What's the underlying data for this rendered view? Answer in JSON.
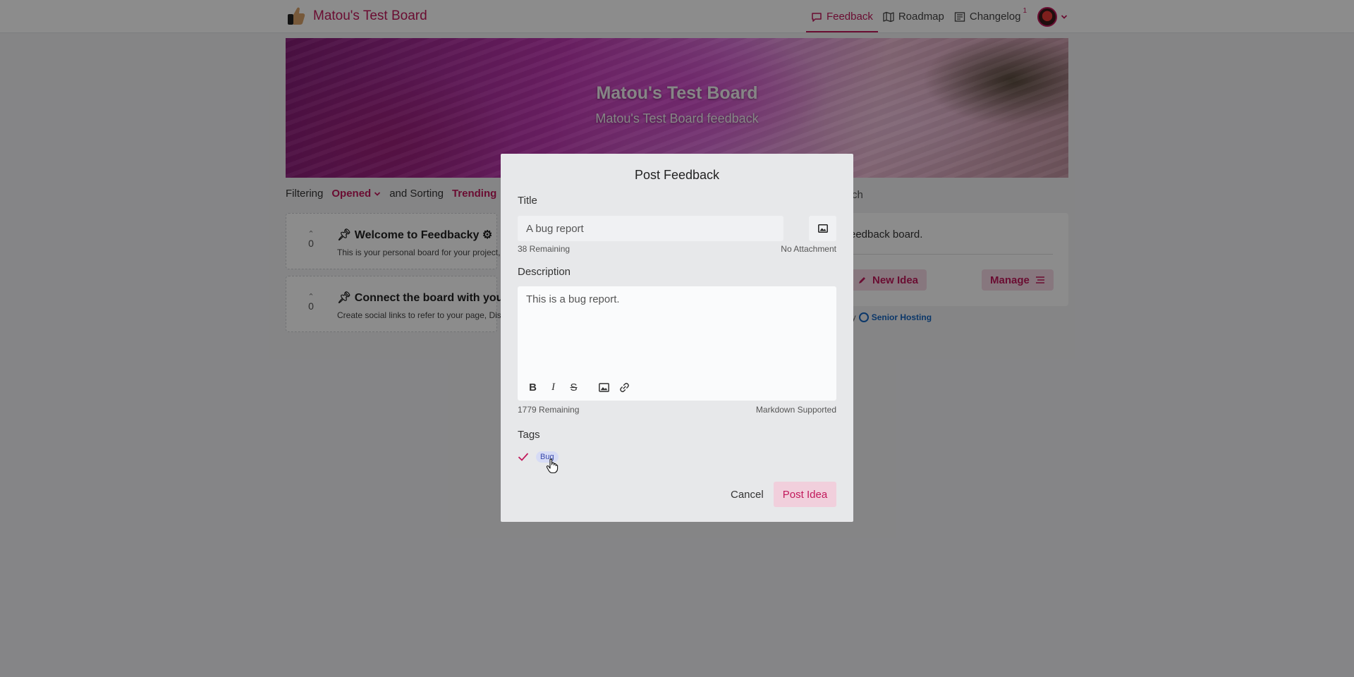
{
  "navbar": {
    "brand_title": "Matou's Test Board",
    "links": [
      {
        "label": "Feedback",
        "icon": "chat-bubble-icon",
        "active": true
      },
      {
        "label": "Roadmap",
        "icon": "map-icon",
        "active": false
      },
      {
        "label": "Changelog",
        "icon": "newspaper-icon",
        "active": false,
        "badge": "1"
      }
    ]
  },
  "banner": {
    "title": "Matou's Test Board",
    "subtitle": "Matou's Test Board feedback"
  },
  "filters": {
    "filtering_label": "Filtering",
    "filtering_value": "Opened",
    "sorting_label": "and Sorting",
    "sorting_value": "Trending",
    "search_fragment": "ch"
  },
  "posts": [
    {
      "title": "Welcome to Feedbacky",
      "votes": "0",
      "description": "This is your personal board for your project, fe"
    },
    {
      "title": "Connect the board with your pr",
      "votes": "0",
      "description": "Create social links to refer to your page, Disco"
    }
  ],
  "side_panel": {
    "text_fragment": "eedback board.",
    "new_idea_label": "New Idea",
    "manage_label": "Manage",
    "powered_prefix": "l by",
    "powered_link": "Senior Hosting"
  },
  "modal": {
    "title": "Post Feedback",
    "title_label": "Title",
    "title_value": "A bug report",
    "title_remaining": "38 Remaining",
    "attachment_status": "No Attachment",
    "description_label": "Description",
    "description_value": "This is a bug report.",
    "description_remaining": "1779 Remaining",
    "markdown_note": "Markdown Supported",
    "tags_label": "Tags",
    "tags": [
      {
        "label": "Bug",
        "checked": true
      }
    ],
    "cancel_label": "Cancel",
    "post_label": "Post Idea"
  },
  "colors": {
    "accent": "#c2185b",
    "tag_bg": "#d6dbf5",
    "tag_text": "#3949ab"
  }
}
